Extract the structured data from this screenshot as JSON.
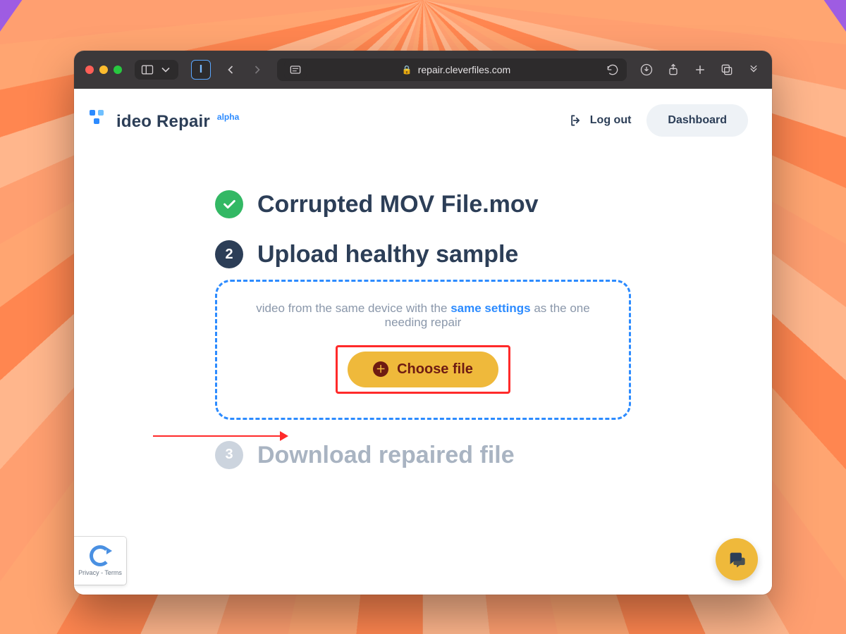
{
  "browser": {
    "url_display": "repair.cleverfiles.com"
  },
  "brand": {
    "name": "ideo Repair",
    "badge": "alpha"
  },
  "header": {
    "logout_label": "Log out",
    "dashboard_label": "Dashboard"
  },
  "steps": {
    "step1": {
      "filename": "Corrupted MOV File.mov"
    },
    "step2": {
      "number": "2",
      "title": "Upload healthy sample",
      "hint_pre": "video from the same device with the ",
      "hint_link": "same settings",
      "hint_post": " as the one needing repair",
      "choose_label": "Choose file"
    },
    "step3": {
      "number": "3",
      "title": "Download repaired file"
    }
  },
  "recaptcha": {
    "label": "Privacy - Terms"
  }
}
